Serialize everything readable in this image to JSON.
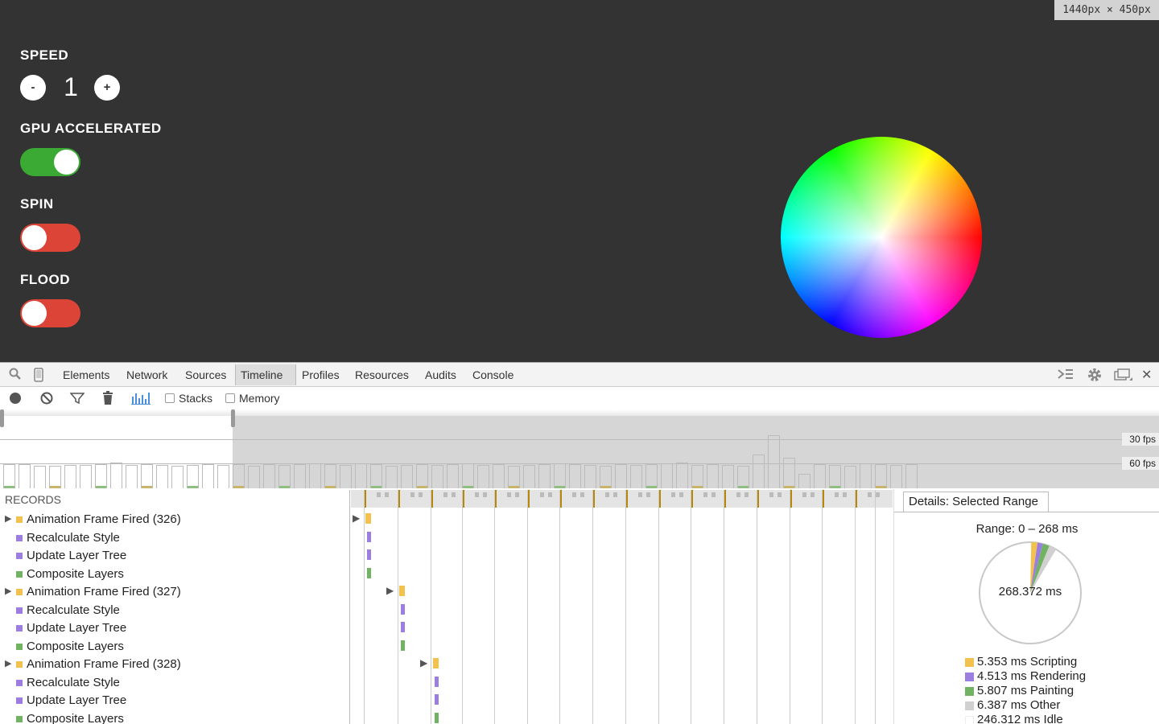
{
  "demo": {
    "viewport_size": "1440px × 450px",
    "speed": {
      "title": "SPEED",
      "minus": "-",
      "value": "1",
      "plus": "+"
    },
    "gpu": {
      "title": "GPU ACCELERATED",
      "on": true
    },
    "spin": {
      "title": "SPIN",
      "on": false
    },
    "flood": {
      "title": "FLOOD",
      "on": false
    }
  },
  "devtools": {
    "tabs": [
      "Elements",
      "Network",
      "Sources",
      "Timeline",
      "Profiles",
      "Resources",
      "Audits",
      "Console"
    ],
    "selected_tab": "Timeline",
    "toolbar": {
      "stacks_label": "Stacks",
      "memory_label": "Memory"
    },
    "overview": {
      "fps30": "30 fps",
      "fps60": "60 fps"
    },
    "records_header": "RECORDS",
    "records": [
      {
        "label": "Animation Frame Fired (326)",
        "type": "scripting",
        "expandable": true
      },
      {
        "label": "Recalculate Style",
        "type": "rendering",
        "expandable": false
      },
      {
        "label": "Update Layer Tree",
        "type": "rendering",
        "expandable": false
      },
      {
        "label": "Composite Layers",
        "type": "painting",
        "expandable": false
      },
      {
        "label": "Animation Frame Fired (327)",
        "type": "scripting",
        "expandable": true
      },
      {
        "label": "Recalculate Style",
        "type": "rendering",
        "expandable": false
      },
      {
        "label": "Update Layer Tree",
        "type": "rendering",
        "expandable": false
      },
      {
        "label": "Composite Layers",
        "type": "painting",
        "expandable": false
      },
      {
        "label": "Animation Frame Fired (328)",
        "type": "scripting",
        "expandable": true
      },
      {
        "label": "Recalculate Style",
        "type": "rendering",
        "expandable": false
      },
      {
        "label": "Update Layer Tree",
        "type": "rendering",
        "expandable": false
      },
      {
        "label": "Composite Layers",
        "type": "painting",
        "expandable": false
      }
    ],
    "details": {
      "tab": "Details: Selected Range",
      "range": "Range: 0 – 268 ms",
      "total": "268.372 ms",
      "legend": [
        {
          "label": "5.353 ms Scripting",
          "value": 5.353,
          "color": "#f2c14e"
        },
        {
          "label": "4.513 ms Rendering",
          "value": 4.513,
          "color": "#9c7de0"
        },
        {
          "label": "5.807 ms Painting",
          "value": 5.807,
          "color": "#71b363"
        },
        {
          "label": "6.387 ms Other",
          "value": 6.387,
          "color": "#d0d0d0"
        },
        {
          "label": "246.312 ms Idle",
          "value": 246.312,
          "color": "#ffffff"
        }
      ]
    }
  },
  "colors": {
    "scripting": "#f2c14e",
    "rendering": "#9c7de0",
    "painting": "#71b363",
    "toggle_on": "#3aaa35",
    "toggle_off": "#db4437"
  }
}
